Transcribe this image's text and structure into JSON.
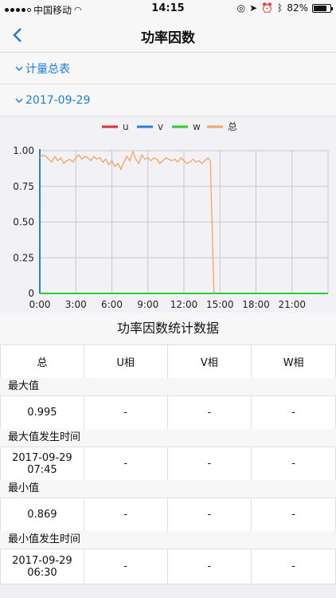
{
  "status_bar": {
    "carrier": "中国移动",
    "time": "14:15",
    "battery": "82%",
    "battery_level": 0.82
  },
  "nav": {
    "title": "功率因数"
  },
  "sections": {
    "meter": "计量总表",
    "date": "2017-09-29"
  },
  "chart_data": {
    "type": "line",
    "legend": [
      "u",
      "v",
      "w",
      "总"
    ],
    "colors": {
      "u": "#e03030",
      "v": "#2a7fd4",
      "w": "#2ecc2e",
      "总": "#f4a460"
    },
    "x_ticks": [
      "0:00",
      "3:00",
      "6:00",
      "9:00",
      "12:00",
      "15:00",
      "18:00",
      "21:00"
    ],
    "xlim": [
      0,
      24
    ],
    "ylim": [
      0,
      1.0
    ],
    "y_ticks": [
      "0",
      "0.25",
      "0.50",
      "0.75",
      "1.00"
    ],
    "grid": true,
    "series": [
      {
        "name": "u",
        "x": [
          0,
          24
        ],
        "y": [
          0,
          0
        ]
      },
      {
        "name": "v",
        "x": [
          0,
          24
        ],
        "y": [
          0,
          0
        ]
      },
      {
        "name": "w",
        "x": [
          0,
          24
        ],
        "y": [
          0,
          0
        ]
      },
      {
        "name": "总",
        "x": [
          0,
          0.25,
          0.5,
          0.75,
          1.0,
          1.25,
          1.5,
          1.75,
          2.0,
          2.25,
          2.5,
          2.75,
          3.0,
          3.25,
          3.5,
          3.75,
          4.0,
          4.25,
          4.5,
          4.75,
          5.0,
          5.25,
          5.5,
          5.75,
          6.0,
          6.25,
          6.5,
          6.75,
          7.0,
          7.25,
          7.5,
          7.75,
          8.0,
          8.25,
          8.5,
          8.75,
          9.0,
          9.25,
          9.5,
          9.75,
          10.0,
          10.25,
          10.5,
          10.75,
          11.0,
          11.25,
          11.5,
          11.75,
          12.0,
          12.25,
          12.5,
          12.75,
          13.0,
          13.25,
          13.5,
          13.75,
          14.0,
          14.2,
          14.5
        ],
        "y": [
          0.95,
          0.97,
          0.96,
          0.94,
          0.92,
          0.96,
          0.93,
          0.95,
          0.91,
          0.93,
          0.94,
          0.92,
          0.95,
          0.97,
          0.94,
          0.96,
          0.95,
          0.93,
          0.96,
          0.94,
          0.95,
          0.92,
          0.94,
          0.9,
          0.93,
          0.89,
          0.91,
          0.87,
          0.92,
          0.96,
          0.93,
          0.995,
          0.94,
          0.91,
          0.97,
          0.94,
          0.95,
          0.93,
          0.95,
          0.94,
          0.91,
          0.93,
          0.95,
          0.94,
          0.93,
          0.94,
          0.92,
          0.95,
          0.93,
          0.91,
          0.92,
          0.94,
          0.92,
          0.93,
          0.91,
          0.93,
          0.95,
          0.93,
          0.0
        ]
      }
    ]
  },
  "stats": {
    "title": "功率因数统计数据",
    "headers": [
      "总",
      "U相",
      "V相",
      "W相"
    ],
    "groups": [
      {
        "label": "最大值",
        "values": [
          "0.995",
          "-",
          "-",
          "-"
        ]
      },
      {
        "label": "最大值发生时间",
        "values": [
          "2017-09-29 07:45",
          "-",
          "-",
          "-"
        ]
      },
      {
        "label": "最小值",
        "values": [
          "0.869",
          "-",
          "-",
          "-"
        ]
      },
      {
        "label": "最小值发生时间",
        "values": [
          "2017-09-29 06:30",
          "-",
          "-",
          "-"
        ]
      }
    ]
  }
}
